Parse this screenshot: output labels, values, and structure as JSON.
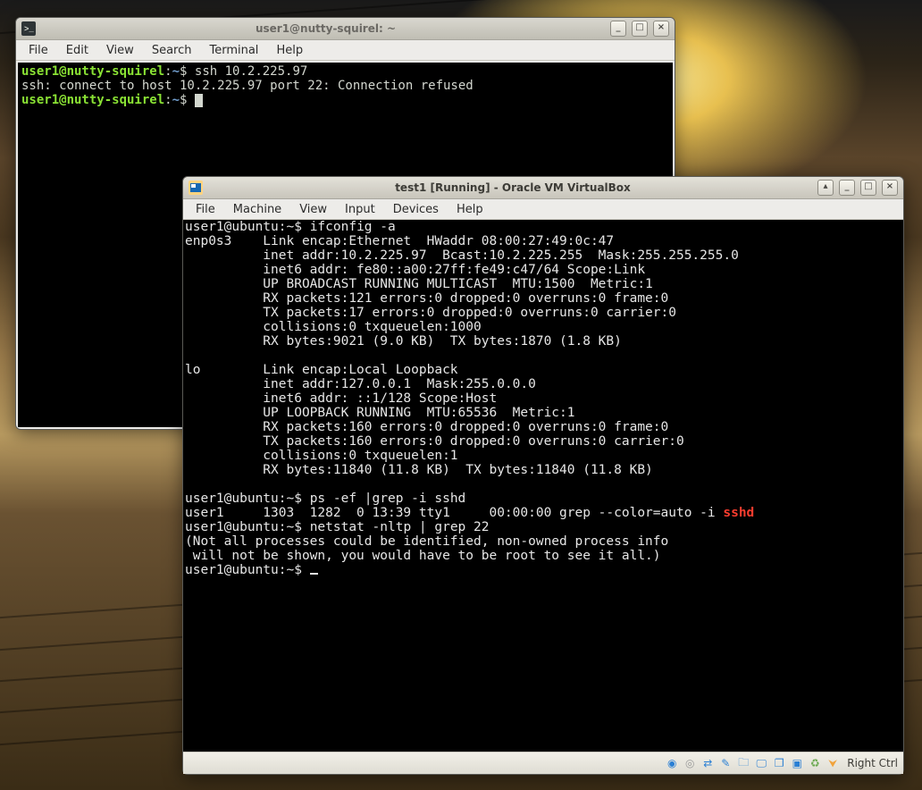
{
  "host_terminal": {
    "title": "user1@nutty-squirel: ~",
    "menu": [
      "File",
      "Edit",
      "View",
      "Search",
      "Terminal",
      "Help"
    ],
    "prompt_user": "user1@nutty-squirel",
    "prompt_path": "~",
    "prompt_sep": ":",
    "prompt_end": "$ ",
    "cmd1": "ssh 10.2.225.97",
    "out1": "ssh: connect to host 10.2.225.97 port 22: Connection refused"
  },
  "vbox_window": {
    "title": "test1 [Running] - Oracle VM VirtualBox",
    "menu": [
      "File",
      "Machine",
      "View",
      "Input",
      "Devices",
      "Help"
    ],
    "hostkey": "Right Ctrl",
    "console": {
      "prompt": "user1@ubuntu:~$ ",
      "cmd_ifconfig": "ifconfig -a",
      "ifconfig_out": "enp0s3    Link encap:Ethernet  HWaddr 08:00:27:49:0c:47\n          inet addr:10.2.225.97  Bcast:10.2.225.255  Mask:255.255.255.0\n          inet6 addr: fe80::a00:27ff:fe49:c47/64 Scope:Link\n          UP BROADCAST RUNNING MULTICAST  MTU:1500  Metric:1\n          RX packets:121 errors:0 dropped:0 overruns:0 frame:0\n          TX packets:17 errors:0 dropped:0 overruns:0 carrier:0\n          collisions:0 txqueuelen:1000\n          RX bytes:9021 (9.0 KB)  TX bytes:1870 (1.8 KB)\n\nlo        Link encap:Local Loopback\n          inet addr:127.0.0.1  Mask:255.0.0.0\n          inet6 addr: ::1/128 Scope:Host\n          UP LOOPBACK RUNNING  MTU:65536  Metric:1\n          RX packets:160 errors:0 dropped:0 overruns:0 frame:0\n          TX packets:160 errors:0 dropped:0 overruns:0 carrier:0\n          collisions:0 txqueuelen:1\n          RX bytes:11840 (11.8 KB)  TX bytes:11840 (11.8 KB)\n",
      "cmd_ps": "ps -ef |grep -i sshd",
      "ps_out_pre": "user1     1303  1282  0 13:39 tty1     00:00:00 grep --color=auto -i ",
      "ps_out_hl": "sshd",
      "cmd_netstat": "netstat -nltp | grep 22",
      "netstat_out": "(Not all processes could be identified, non-owned process info\n will not be shown, you would have to be root to see it all.)"
    }
  }
}
